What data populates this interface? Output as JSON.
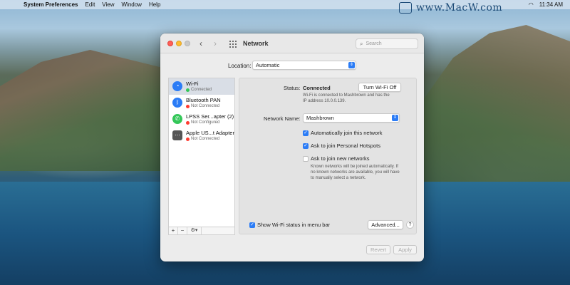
{
  "menubar": {
    "app_name": "System Preferences",
    "items": [
      "Edit",
      "View",
      "Window",
      "Help"
    ],
    "time": "11:34 AM",
    "watermark": "www.MacW.com"
  },
  "window": {
    "title": "Network",
    "search_placeholder": "Search",
    "location_label": "Location:",
    "location_value": "Automatic"
  },
  "services": [
    {
      "name": "Wi-Fi",
      "status": "Connected",
      "status_color": "#34c759",
      "icon": "wifi-icon",
      "selected": true
    },
    {
      "name": "Bluetooth PAN",
      "status": "Not Connected",
      "status_color": "#ff3b30",
      "icon": "bluetooth-icon",
      "selected": false
    },
    {
      "name": "LPSS Ser...apter (2)",
      "status": "Not Configured",
      "status_color": "#ff3b30",
      "icon": "phone-icon",
      "selected": false
    },
    {
      "name": "Apple US...t Adapter",
      "status": "Not Connected",
      "status_color": "#ff3b30",
      "icon": "ethernet-icon",
      "selected": false
    }
  ],
  "sidebar_tools": {
    "add": "+",
    "remove": "−",
    "gear": "⚙︎▾"
  },
  "detail": {
    "status_label": "Status:",
    "status_value": "Connected",
    "turn_off_button": "Turn Wi-Fi Off",
    "status_description_line1": "Wi-Fi is connected to Mashbrown and has the",
    "status_description_line2": "IP address 10.0.0.139.",
    "network_name_label": "Network Name:",
    "network_name_value": "Mashbrown",
    "options": [
      {
        "label": "Automatically join this network",
        "checked": true
      },
      {
        "label": "Ask to join Personal Hotspots",
        "checked": true
      },
      {
        "label": "Ask to join new networks",
        "checked": false
      }
    ],
    "ask_note_line1": "Known networks will be joined automatically. If",
    "ask_note_line2": "no known networks are available, you will have",
    "ask_note_line3": "to manually select a network.",
    "show_status_label": "Show Wi-Fi status in menu bar",
    "show_status_checked": true,
    "advanced_button": "Advanced...",
    "help_button": "?"
  },
  "footer": {
    "revert_button": "Revert",
    "apply_button": "Apply"
  },
  "colors": {
    "accent": "#2b7cf6",
    "connected": "#34c759",
    "disconnected": "#ff3b30"
  }
}
